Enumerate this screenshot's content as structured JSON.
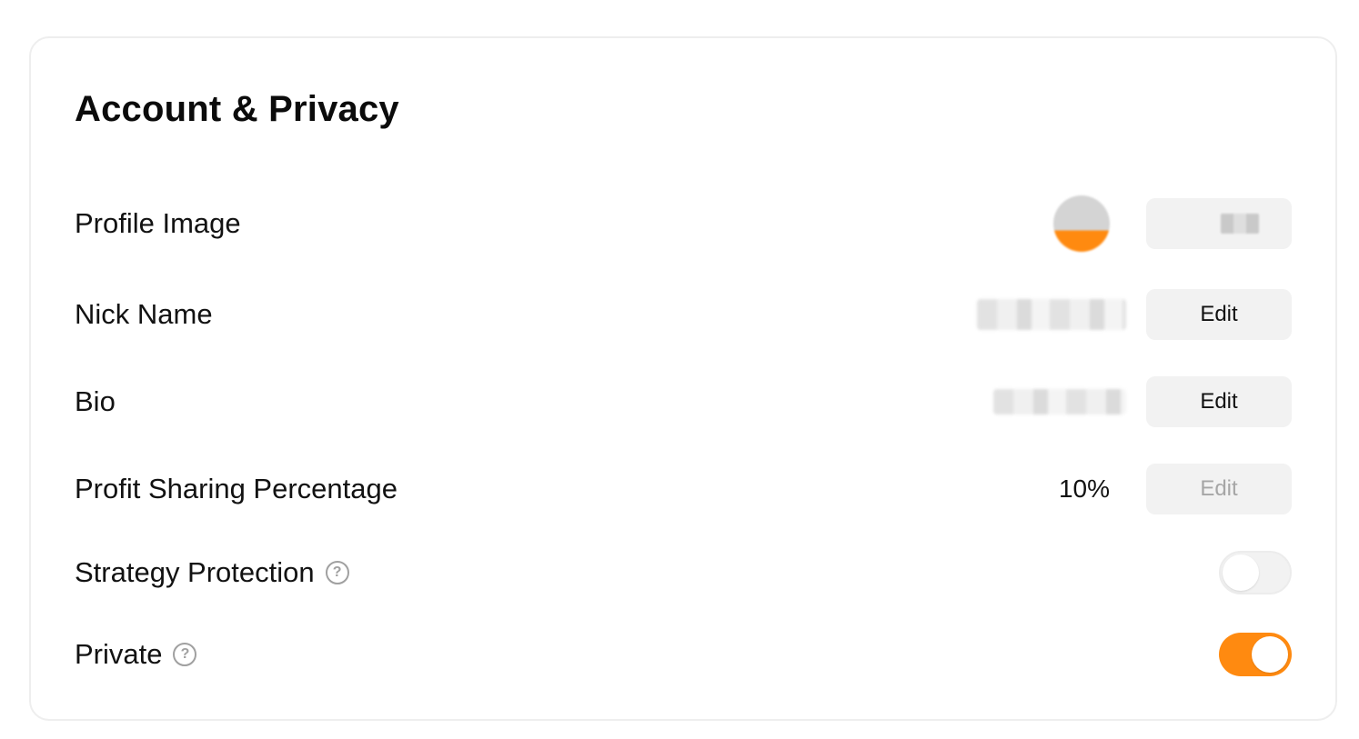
{
  "card": {
    "title": "Account & Privacy"
  },
  "rows": {
    "profile_image": {
      "label": "Profile Image"
    },
    "nick_name": {
      "label": "Nick Name",
      "edit_label": "Edit"
    },
    "bio": {
      "label": "Bio",
      "edit_label": "Edit"
    },
    "profit_sharing": {
      "label": "Profit Sharing Percentage",
      "value": "10%",
      "edit_label": "Edit"
    },
    "strategy_protection": {
      "label": "Strategy Protection",
      "help_icon": "question-circle-icon",
      "enabled": false
    },
    "private": {
      "label": "Private",
      "help_icon": "question-circle-icon",
      "enabled": true
    }
  },
  "colors": {
    "accent": "#ff8a10",
    "button_bg": "#f2f2f2",
    "border": "#eeeeee"
  }
}
